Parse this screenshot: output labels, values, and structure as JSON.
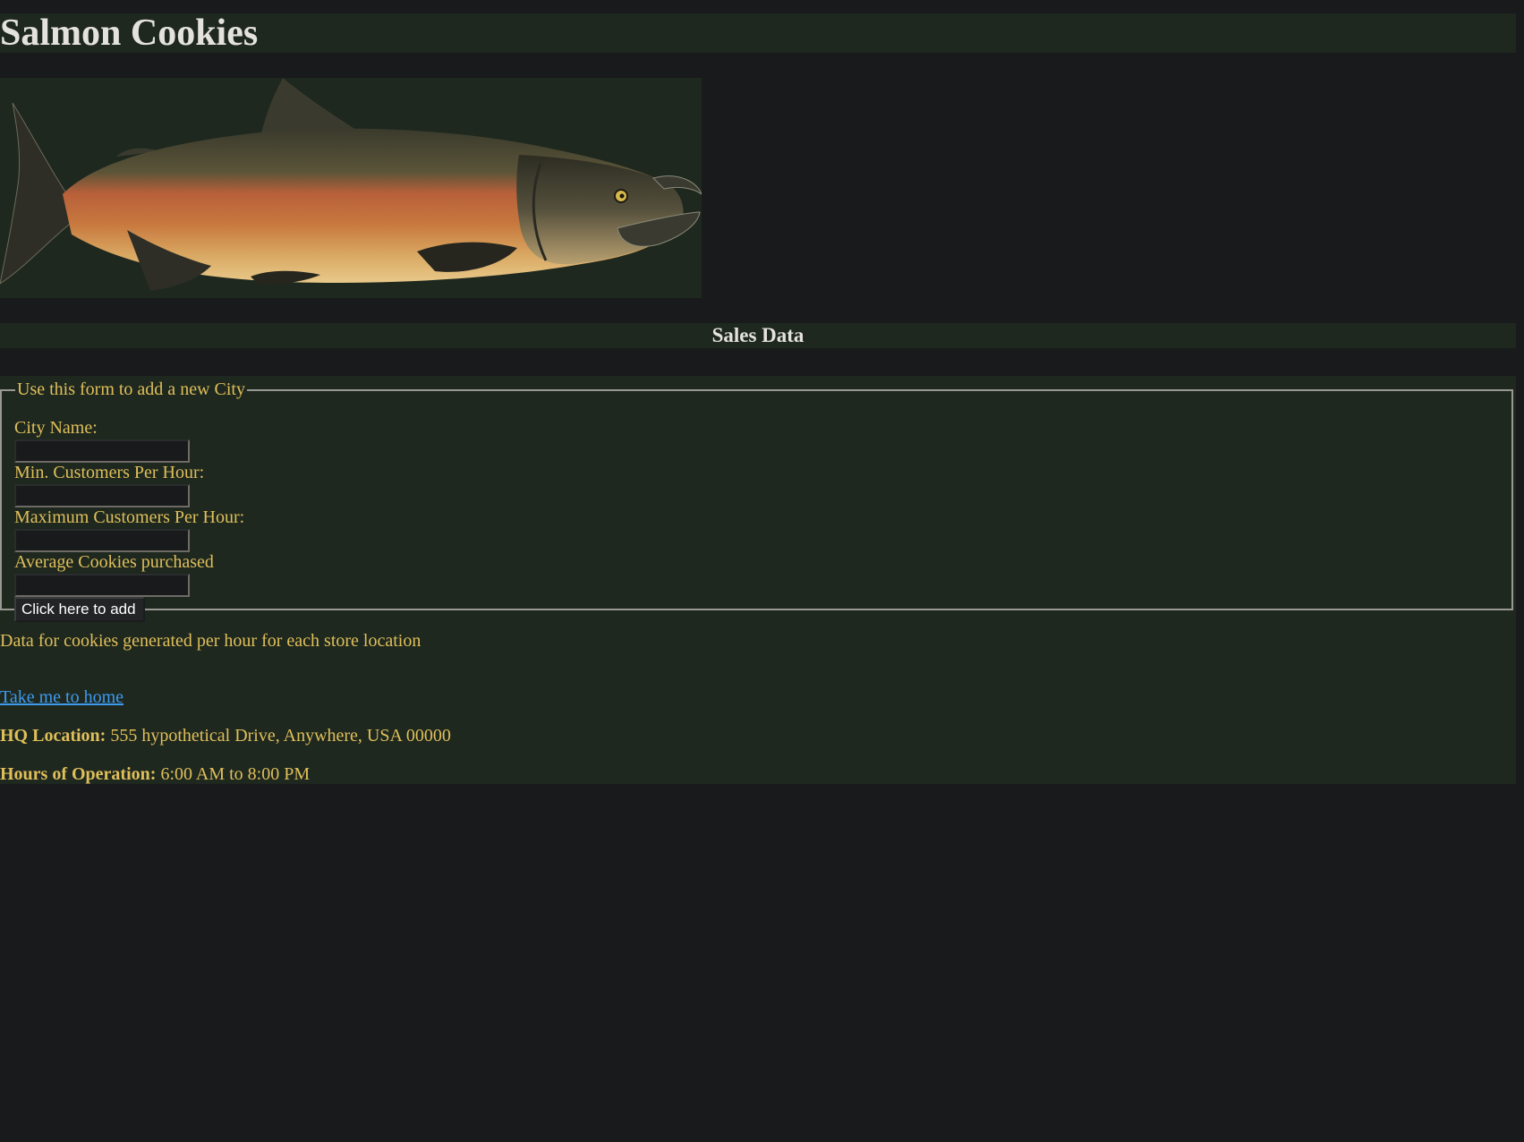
{
  "header": {
    "title": "Salmon Cookies"
  },
  "hero": {
    "image_subject": "salmon"
  },
  "sales": {
    "heading": "Sales Data"
  },
  "form": {
    "legend": "Use this form to add a new City",
    "fields": [
      {
        "label": "City Name:",
        "value": ""
      },
      {
        "label": "Min. Customers Per Hour:",
        "value": ""
      },
      {
        "label": "Maximum Customers Per Hour:",
        "value": ""
      },
      {
        "label": "Average Cookies purchased",
        "value": ""
      }
    ],
    "submit_label": "Click here to add"
  },
  "content": {
    "caption": "Data for cookies generated per hour for each store location",
    "home_link": "Take me to home"
  },
  "footer": {
    "hq_label": "HQ Location:",
    "hq_value": " 555 hypothetical Drive, Anywhere, USA 00000",
    "hours_label": "Hours of Operation:",
    "hours_value": " 6:00 AM to 8:00 PM"
  },
  "colors": {
    "page_bg": "#181a1b",
    "panel_bg": "#1e281f",
    "heading_text": "#e4e2dc",
    "body_text": "#e0bf5a",
    "link": "#3d9aef"
  }
}
